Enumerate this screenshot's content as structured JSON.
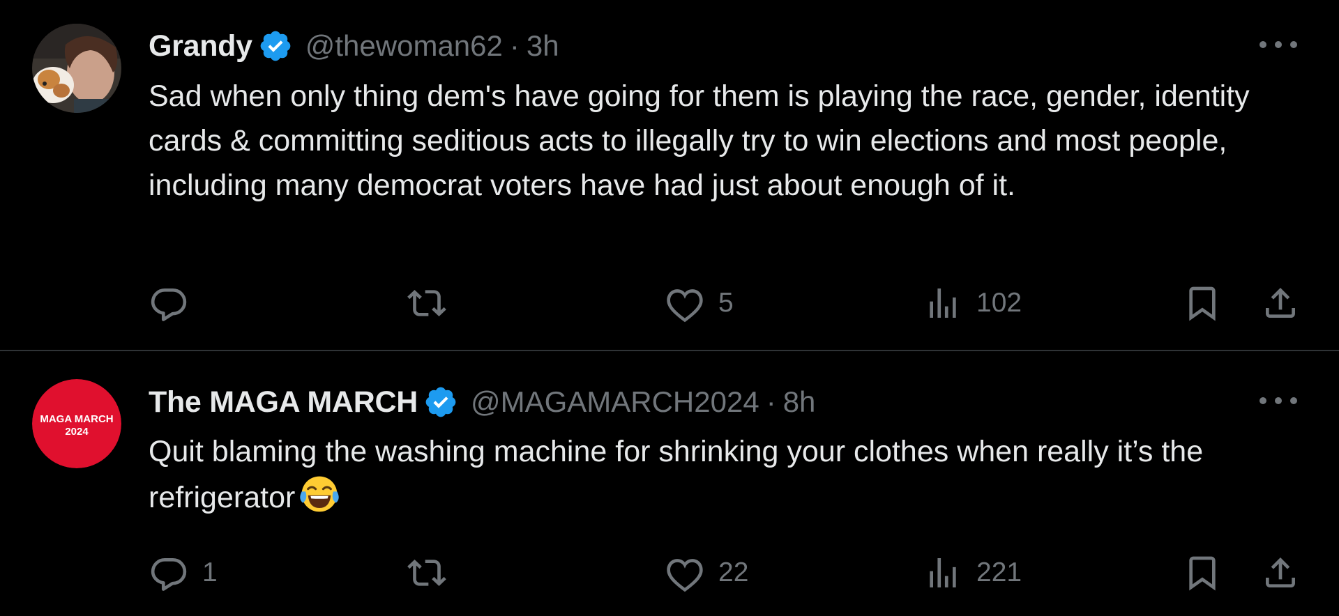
{
  "tweets": [
    {
      "display_name": "Grandy",
      "handle": "@thewoman62",
      "separator": "·",
      "time": "3h",
      "text": "Sad when only thing dem's have going for them is playing the race, gender, identity cards & committing seditious acts to illegally try to win elections and most people, including many democrat voters have had just about enough of it.",
      "emoji": "",
      "avatar": "profile-photo-woman-with-dog",
      "verified": true,
      "replies": "",
      "retweets": "",
      "likes": "5",
      "views": "102"
    },
    {
      "display_name": "The MAGA MARCH",
      "handle": "@MAGAMARCH2024",
      "separator": "·",
      "time": "8h",
      "text": "Quit blaming the washing machine for shrinking your clothes when really it’s the refrigerator",
      "emoji": "face-with-tears-of-joy",
      "avatar": "red-circle-logo",
      "avatar_text_line1": "MAGA MARCH",
      "avatar_text_line2": "2024",
      "verified": true,
      "replies": "1",
      "retweets": "",
      "likes": "22",
      "views": "221"
    }
  ],
  "colors": {
    "background": "#000000",
    "text_primary": "#e7e9ea",
    "text_secondary": "#71767b",
    "verified_blue": "#1d9bf0",
    "divider": "#2f3336",
    "avatar_red": "#e0102e"
  },
  "icons": [
    "reply-icon",
    "retweet-icon",
    "like-icon",
    "views-icon",
    "bookmark-icon",
    "share-icon",
    "more-icon",
    "verified-badge-icon"
  ]
}
